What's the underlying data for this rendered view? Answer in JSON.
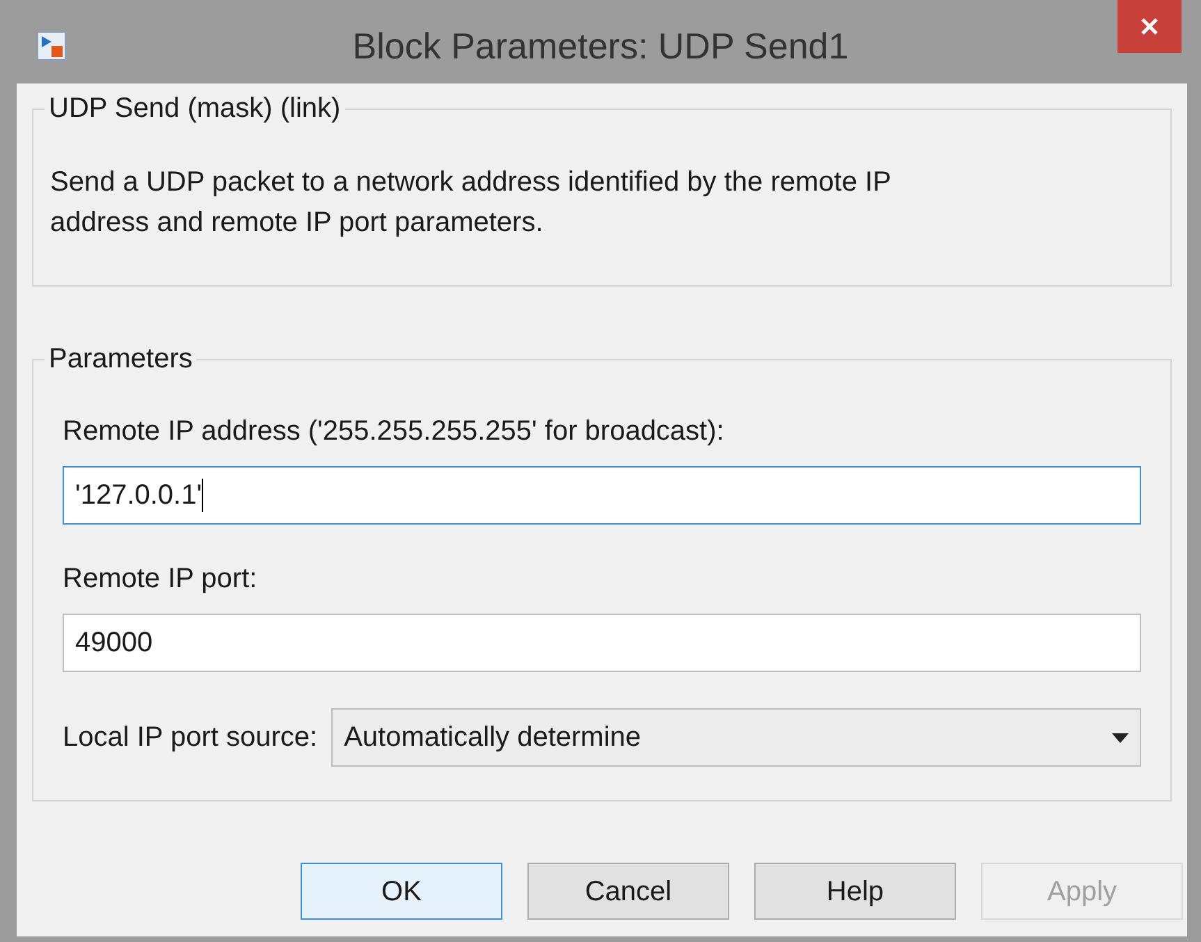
{
  "window": {
    "title": "Block Parameters: UDP Send1"
  },
  "description_group": {
    "legend": "UDP Send (mask) (link)",
    "text": "Send a UDP packet to a network address identified by the remote IP address and remote IP port parameters."
  },
  "parameters": {
    "legend": "Parameters",
    "fields": [
      {
        "kind": "text",
        "label": "Remote IP address ('255.255.255.255' for broadcast):",
        "value": "'127.0.0.1'",
        "focused": true
      },
      {
        "kind": "text",
        "label": "Remote IP port:",
        "value": "49000",
        "focused": false
      },
      {
        "kind": "dropdown",
        "label": "Local IP port source:",
        "value": "Automatically determine"
      }
    ]
  },
  "buttons": [
    {
      "label": "OK",
      "default": true,
      "disabled": false
    },
    {
      "label": "Cancel",
      "default": false,
      "disabled": false
    },
    {
      "label": "Help",
      "default": false,
      "disabled": false
    },
    {
      "label": "Apply",
      "default": false,
      "disabled": true
    }
  ]
}
